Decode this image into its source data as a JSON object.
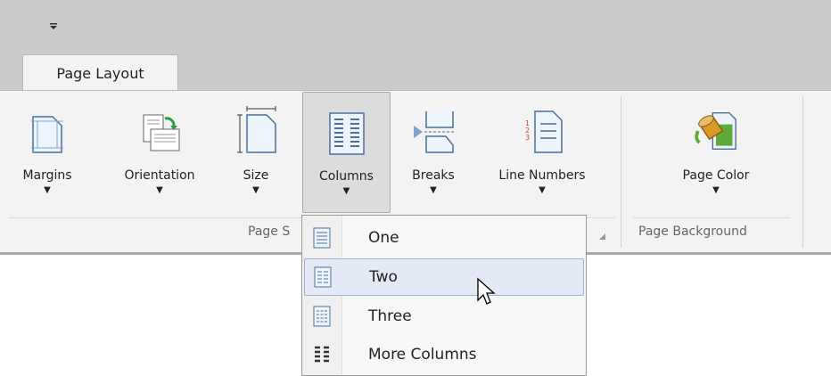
{
  "qat": {
    "icon": "customize-quick-access-arrow-icon"
  },
  "tabs": [
    {
      "label": "Page Layout",
      "active": true
    }
  ],
  "groups": {
    "page_setup": {
      "label": "Page S",
      "buttons": [
        {
          "label": "Margins",
          "icon": "margins-icon"
        },
        {
          "label": "Orientation",
          "icon": "orientation-icon"
        },
        {
          "label": "Size",
          "icon": "size-icon"
        },
        {
          "label": "Columns",
          "icon": "columns-icon",
          "pressed": true
        },
        {
          "label": "Breaks",
          "icon": "breaks-icon"
        },
        {
          "label": "Line Numbers",
          "icon": "line-numbers-icon"
        }
      ]
    },
    "page_background": {
      "label": "Page Background",
      "buttons": [
        {
          "label": "Page Color",
          "icon": "paint-bucket-icon"
        }
      ]
    }
  },
  "columns_menu": {
    "items": [
      {
        "label": "One",
        "icon": "one-column-icon"
      },
      {
        "label": "Two",
        "icon": "two-columns-icon",
        "highlighted": true
      },
      {
        "label": "Three",
        "icon": "three-columns-icon"
      },
      {
        "label": "More Columns",
        "icon": "more-columns-icon"
      }
    ]
  },
  "colors": {
    "ribbon_bg": "#f3f3f3",
    "title_bg": "#cbcbcb",
    "menu_highlight": "#e3e9f5",
    "menu_highlight_border": "#9fb1d4"
  }
}
